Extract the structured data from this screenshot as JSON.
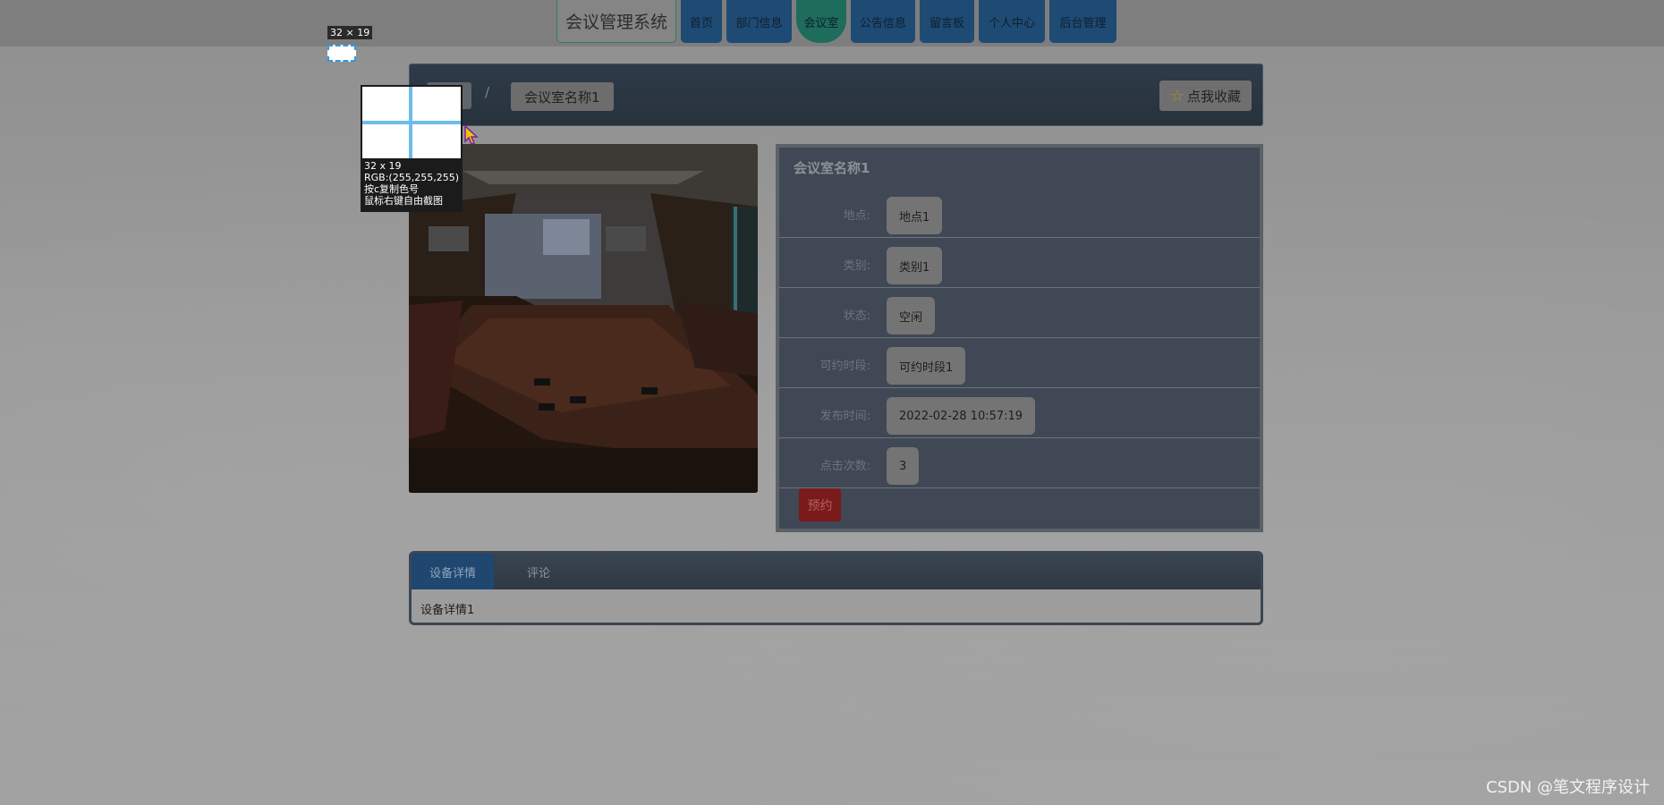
{
  "nav": {
    "brand": "会议管理系统",
    "items": [
      {
        "label": "首页"
      },
      {
        "label": "部门信息"
      },
      {
        "label": "会议室"
      },
      {
        "label": "公告信息"
      },
      {
        "label": "留言板"
      },
      {
        "label": "个人中心"
      },
      {
        "label": "后台管理"
      }
    ]
  },
  "breadcrumb": {
    "separator": "/",
    "current": "会议室名称1",
    "favorite_label": "点我收藏",
    "favorite_icon": "star-icon"
  },
  "detail": {
    "title": "会议室名称1",
    "fields": [
      {
        "label": "地点:",
        "value": "地点1"
      },
      {
        "label": "类别:",
        "value": "类别1"
      },
      {
        "label": "状态:",
        "value": "空闲"
      },
      {
        "label": "可约时段:",
        "value": "可约时段1"
      },
      {
        "label": "发布时间:",
        "value": "2022-02-28 10:57:19"
      },
      {
        "label": "点击次数:",
        "value": "3"
      }
    ],
    "reserve_label": "预约"
  },
  "tabs": {
    "items": [
      {
        "label": "设备详情"
      },
      {
        "label": "评论"
      }
    ],
    "content": "设备详情1"
  },
  "screenshot_tool": {
    "size_label": "32 × 19",
    "mag_size": "32 x 19",
    "mag_rgb": "RGB:(255,255,255)",
    "mag_copy": "按c复制色号",
    "mag_right": "鼠标右键自由截图"
  },
  "watermark": "CSDN @笔文程序设计"
}
